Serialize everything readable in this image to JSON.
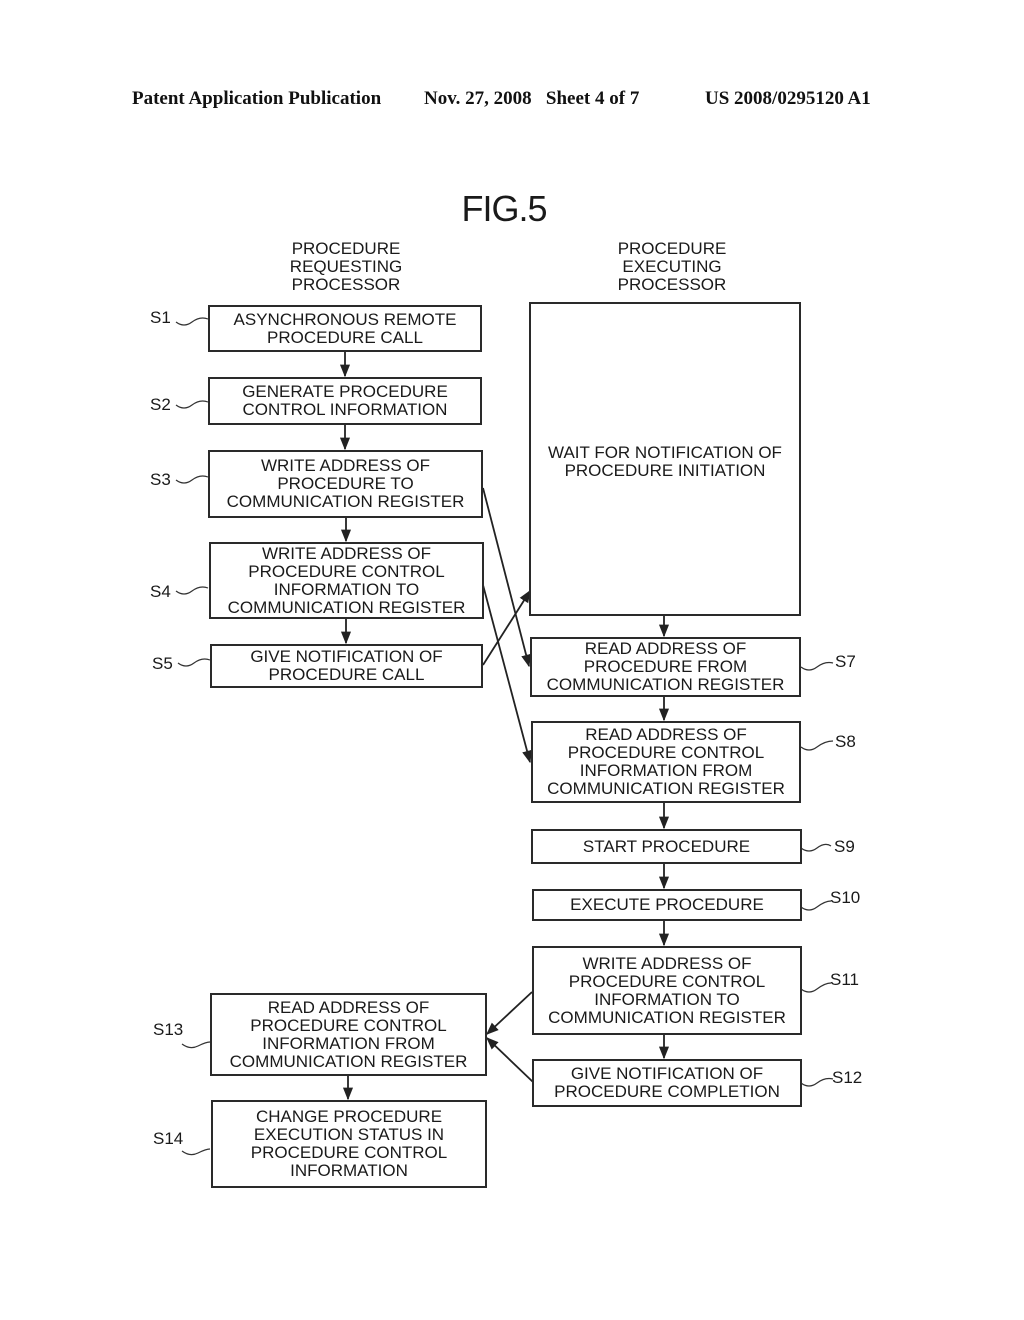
{
  "header": {
    "publication": "Patent Application Publication",
    "date_sheet": "Nov. 27, 2008   Sheet 4 of 7",
    "number": "US 2008/0295120 A1"
  },
  "figure": {
    "title": "FIG.5",
    "columns": {
      "left": "PROCEDURE\nREQUESTING\nPROCESSOR",
      "right": "PROCEDURE\nEXECUTING\nPROCESSOR"
    },
    "steps": {
      "s1": {
        "label": "S1",
        "text": "ASYNCHRONOUS REMOTE\nPROCEDURE CALL"
      },
      "s2": {
        "label": "S2",
        "text": "GENERATE PROCEDURE\nCONTROL INFORMATION"
      },
      "s3": {
        "label": "S3",
        "text": "WRITE ADDRESS OF\nPROCEDURE TO\nCOMMUNICATION REGISTER"
      },
      "s4": {
        "label": "S4",
        "text": "WRITE ADDRESS OF\nPROCEDURE CONTROL\nINFORMATION TO\nCOMMUNICATION REGISTER"
      },
      "s5": {
        "label": "S5",
        "text": "GIVE NOTIFICATION OF\nPROCEDURE CALL"
      },
      "s6": {
        "label": "",
        "text": "WAIT FOR NOTIFICATION OF\nPROCEDURE INITIATION"
      },
      "s7": {
        "label": "S7",
        "text": "READ ADDRESS OF\nPROCEDURE FROM\nCOMMUNICATION REGISTER"
      },
      "s8": {
        "label": "S8",
        "text": "READ ADDRESS OF\nPROCEDURE CONTROL\nINFORMATION FROM\nCOMMUNICATION REGISTER"
      },
      "s9": {
        "label": "S9",
        "text": "START PROCEDURE"
      },
      "s10": {
        "label": "S10",
        "text": "EXECUTE PROCEDURE"
      },
      "s11": {
        "label": "S11",
        "text": "WRITE ADDRESS OF\nPROCEDURE CONTROL\nINFORMATION TO\nCOMMUNICATION REGISTER"
      },
      "s12": {
        "label": "S12",
        "text": "GIVE NOTIFICATION OF\nPROCEDURE COMPLETION"
      },
      "s13": {
        "label": "S13",
        "text": "READ ADDRESS OF\nPROCEDURE CONTROL\nINFORMATION FROM\nCOMMUNICATION REGISTER"
      },
      "s14": {
        "label": "S14",
        "text": "CHANGE PROCEDURE\nEXECUTION STATUS IN\nPROCEDURE CONTROL\nINFORMATION"
      }
    }
  }
}
